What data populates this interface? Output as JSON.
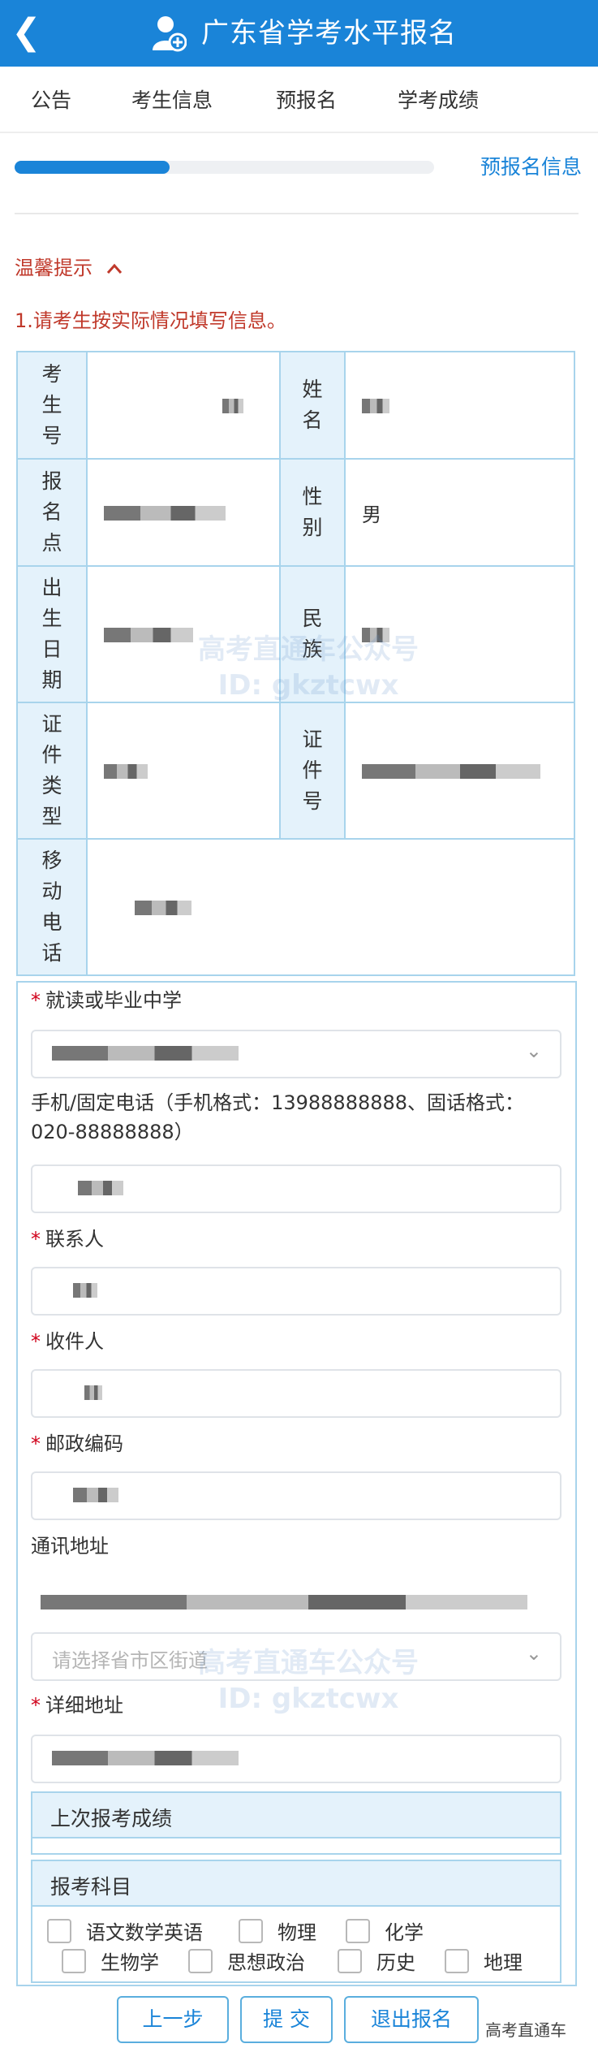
{
  "header": {
    "back_icon": "chevron-left-icon",
    "app_icon": "user-add-icon",
    "title": "广东省学考水平报名"
  },
  "tabs": [
    "公告",
    "考生信息",
    "预报名",
    "学考成绩"
  ],
  "progress": {
    "value": 0.37,
    "label": "预报名信息"
  },
  "tips": {
    "title": "温馨提示",
    "toggle_icon": "chevron-up-icon",
    "text": "1.请考生按实际情况填写信息。"
  },
  "info_table": {
    "exam_no_label": "考生号",
    "name_label": "姓名",
    "site_label": "报名点",
    "gender_label": "性别",
    "gender_value": "男",
    "birth_label": "出生日期",
    "ethnic_label": "民族",
    "id_type_label": "证件类型",
    "id_no_label": "证件号",
    "mobile_label": "移动电话"
  },
  "form": {
    "school_label": "就读或毕业中学",
    "phone_label": "手机/固定电话（手机格式：13988888888、固话格式：020-88888888）",
    "contact_label": "联系人",
    "recipient_label": "收件人",
    "postcode_label": "邮政编码",
    "address_label": "通讯地址",
    "region_placeholder": "请选择省市区街道",
    "detail_label": "详细地址"
  },
  "last_scores": {
    "title": "上次报考成绩"
  },
  "subjects": {
    "title": "报考科目",
    "options": [
      "语文数学英语",
      "物理",
      "化学",
      "生物学",
      "思想政治",
      "历史",
      "地理"
    ]
  },
  "buttons": {
    "prev": "上一步",
    "submit": "提 交",
    "exit": "退出报名"
  },
  "footer_mark": "高考直通车",
  "watermark": {
    "line1": "高考直通车公众号",
    "line2": "ID: gkztcwx"
  },
  "colors": {
    "primary": "#1a84d8",
    "required": "#d0021b",
    "tip": "#c0392b",
    "table_border": "#a8d4ec",
    "label_bg": "#e4f2fb"
  }
}
